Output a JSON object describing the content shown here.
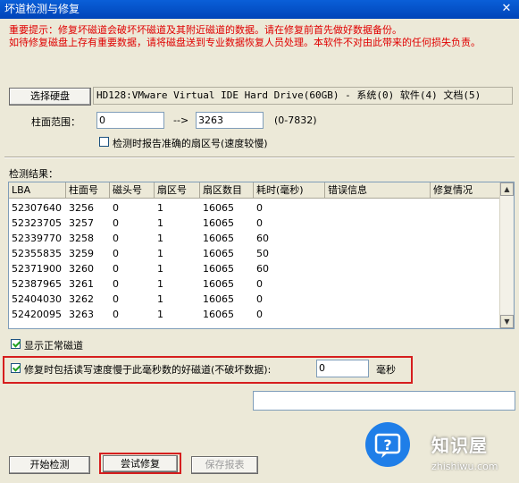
{
  "window": {
    "title": "坏道检测与修复",
    "close_glyph": "✕"
  },
  "warning": {
    "line1": "重要提示：修复坏磁道会破坏坏磁道及其附近磁道的数据。请在修复前首先做好数据备份。",
    "line2": "如待修复磁盘上存有重要数据，请将磁盘送到专业数据恢复人员处理。本软件不对由此带来的任何损失负责。"
  },
  "drive": {
    "select_label": "选择硬盘",
    "name": "HD128:VMware Virtual IDE Hard Drive(60GB) - 系统(0) 软件(4) 文档(5)"
  },
  "range": {
    "label": "柱面范围：",
    "start": "0",
    "arrow": "-->",
    "end": "3263",
    "hint": "(0-7832)"
  },
  "options": {
    "accurate_sector_label": "检测时报告准确的扇区号(速度较慢)",
    "accurate_sector_checked": false,
    "show_normal_label": "显示正常磁道",
    "show_normal_checked": true,
    "slow_repair_label": "修复时包括读写速度慢于此毫秒数的好磁道(不破坏数据):",
    "slow_repair_checked": true,
    "slow_repair_value": "0",
    "slow_repair_unit": "毫秒"
  },
  "results": {
    "label": "检测结果：",
    "columns": [
      "LBA",
      "柱面号",
      "磁头号",
      "扇区号",
      "扇区数目",
      "耗时(毫秒)",
      "错误信息",
      "修复情况"
    ],
    "rows": [
      [
        "52307640",
        "3256",
        "0",
        "1",
        "16065",
        "0",
        "",
        ""
      ],
      [
        "52323705",
        "3257",
        "0",
        "1",
        "16065",
        "0",
        "",
        ""
      ],
      [
        "52339770",
        "3258",
        "0",
        "1",
        "16065",
        "60",
        "",
        ""
      ],
      [
        "52355835",
        "3259",
        "0",
        "1",
        "16065",
        "50",
        "",
        ""
      ],
      [
        "52371900",
        "3260",
        "0",
        "1",
        "16065",
        "60",
        "",
        ""
      ],
      [
        "52387965",
        "3261",
        "0",
        "1",
        "16065",
        "0",
        "",
        ""
      ],
      [
        "52404030",
        "3262",
        "0",
        "1",
        "16065",
        "0",
        "",
        ""
      ],
      [
        "52420095",
        "3263",
        "0",
        "1",
        "16065",
        "0",
        "",
        ""
      ]
    ]
  },
  "buttons": {
    "start": "开始检测",
    "try_repair": "尝试修复",
    "save_report": "保存报表"
  },
  "watermark": {
    "title": "知识屋",
    "sub": "zhishiwu.com"
  },
  "colors": {
    "title_bar": "#0a5fd8",
    "warning": "#e00000",
    "highlight_box": "#d61e1e"
  }
}
